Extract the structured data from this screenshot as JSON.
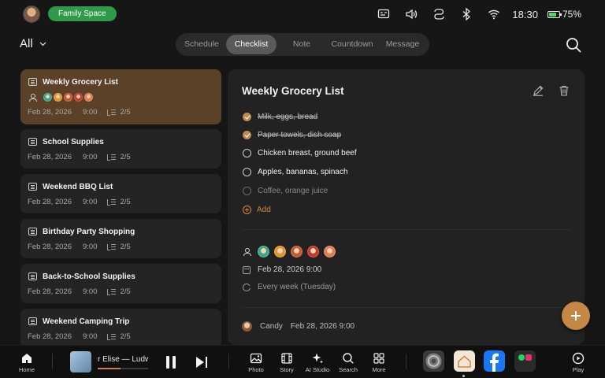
{
  "status": {
    "family_label": "Family Space",
    "time": "18:30",
    "battery_pct": "75%",
    "battery_level": 0.75,
    "icons": [
      "caption-icon",
      "volume-icon",
      "link-icon",
      "bluetooth-icon",
      "wifi-icon"
    ]
  },
  "header": {
    "filter_label": "All",
    "tabs": [
      "Schedule",
      "Checklist",
      "Note",
      "Countdown",
      "Message"
    ],
    "active_tab": "Checklist"
  },
  "lists": [
    {
      "title": "Weekly Grocery List",
      "date": "Feb 28, 2026",
      "time": "9:00",
      "progress": "2/5",
      "selected": true
    },
    {
      "title": "School Supplies",
      "date": "Feb 28, 2026",
      "time": "9:00",
      "progress": "2/5"
    },
    {
      "title": "Weekend BBQ List",
      "date": "Feb 28, 2026",
      "time": "9:00",
      "progress": "2/5"
    },
    {
      "title": "Birthday Party Shopping",
      "date": "Feb 28, 2026",
      "time": "9:00",
      "progress": "2/5"
    },
    {
      "title": "Back-to-School Supplies",
      "date": "Feb 28, 2026",
      "time": "9:00",
      "progress": "2/5"
    },
    {
      "title": "Weekend Camping Trip",
      "date": "Feb 28, 2026",
      "time": "9:00",
      "progress": "2/5"
    }
  ],
  "member_colors": [
    "#3aa58a",
    "#e0952f",
    "#c8572c",
    "#c33a2a",
    "#e27b4f"
  ],
  "detail": {
    "title": "Weekly Grocery List",
    "items": [
      {
        "text": "Milk, eggs, bread",
        "done": true
      },
      {
        "text": "Paper towels, dish soap",
        "done": true
      },
      {
        "text": "Chicken breast, ground beef",
        "done": false
      },
      {
        "text": "Apples, bananas, spinach",
        "done": false
      },
      {
        "text": "Coffee, orange juice",
        "done": false,
        "dim": true
      }
    ],
    "add_label": "Add",
    "datetime": "Feb 28, 2026 9:00",
    "repeat": "Every week (Tuesday)",
    "author": "Candy",
    "author_time": "Feb 28, 2026 9:00"
  },
  "dock": {
    "home_label": "Home",
    "track_title": "r Elise — Ludw",
    "track_progress": 0.45,
    "nav": [
      "Photo",
      "Story",
      "AI Studio",
      "Search",
      "More"
    ],
    "play_label": "Play"
  },
  "colors": {
    "accent": "#c58746",
    "selected_card": "#5b4128",
    "pill_green": "#2f9a4a"
  }
}
